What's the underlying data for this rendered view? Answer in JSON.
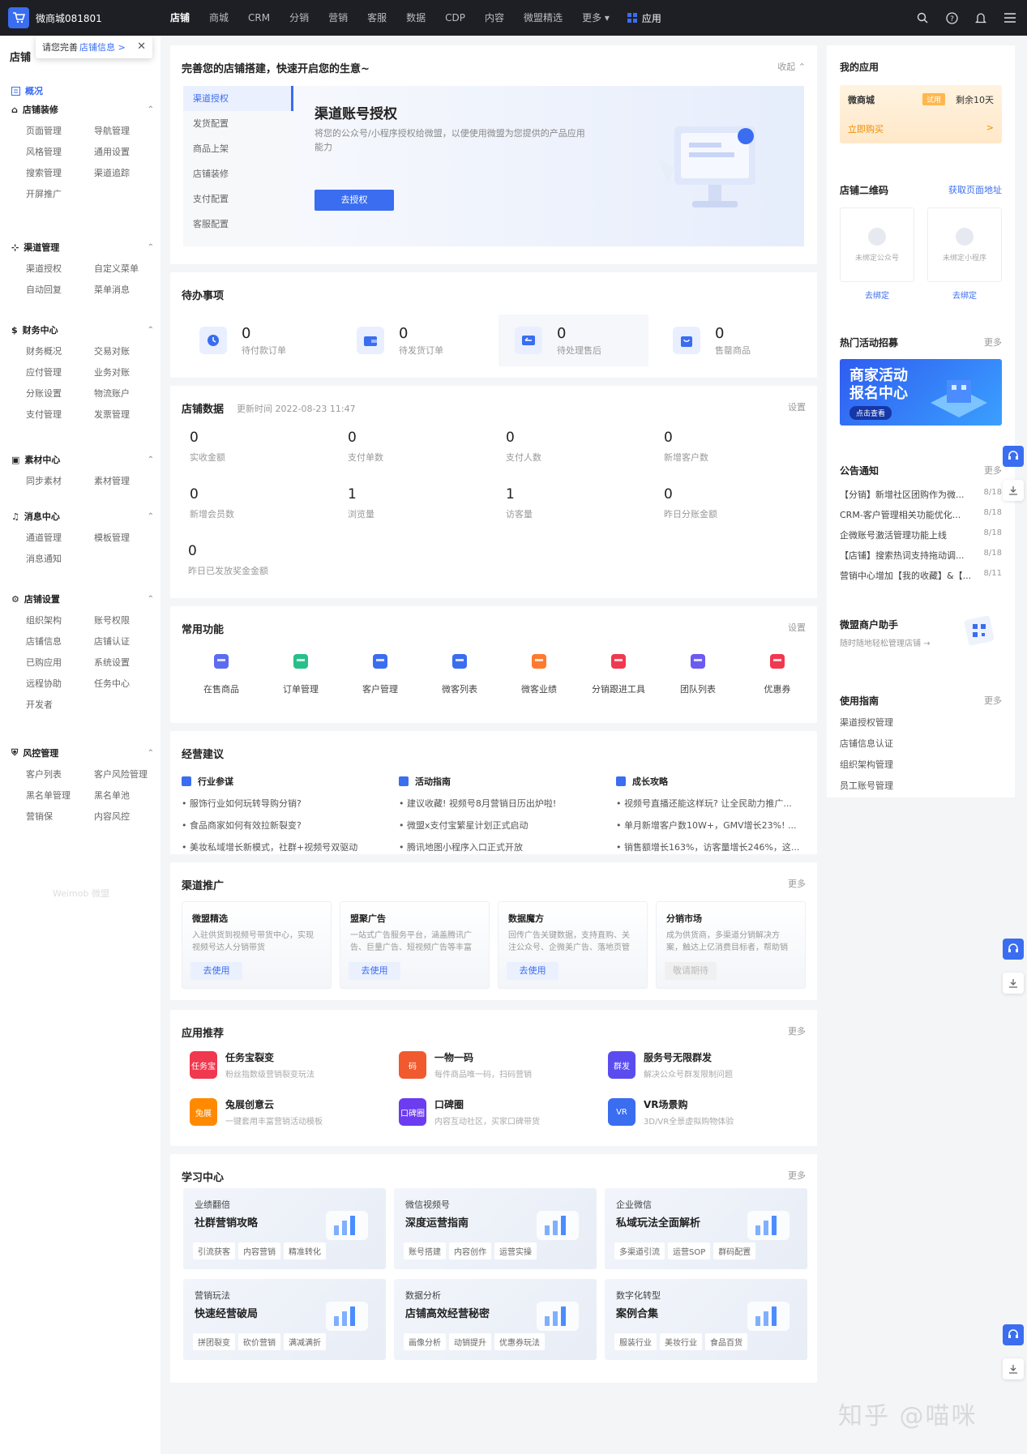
{
  "topbar": {
    "store_name": "微商城081801",
    "nav": [
      "店铺",
      "商城",
      "CRM",
      "分销",
      "营销",
      "客服",
      "数据",
      "CDP",
      "内容",
      "微盟精选",
      "更多 ▾"
    ],
    "apps_label": "应用"
  },
  "sidebar": {
    "title": "店铺",
    "tooltip": {
      "text": "请您完善",
      "link": "店铺信息 >",
      "close": "✕"
    },
    "overview": "概况",
    "groups": [
      {
        "name": "店铺装修",
        "items": [
          "页面管理",
          "导航管理",
          "风格管理",
          "通用设置",
          "搜索管理",
          "渠道追踪",
          "开屏推广"
        ]
      },
      {
        "name": "渠道管理",
        "items": [
          "渠道授权",
          "自定义菜单",
          "自动回复",
          "菜单消息"
        ]
      },
      {
        "name": "财务中心",
        "items": [
          "财务概况",
          "交易对账",
          "应付管理",
          "业务对账",
          "分账设置",
          "物流账户",
          "支付管理",
          "发票管理"
        ]
      },
      {
        "name": "素材中心",
        "items": [
          "同步素材",
          "素材管理"
        ]
      },
      {
        "name": "消息中心",
        "items": [
          "通道管理",
          "模板管理",
          "消息通知"
        ]
      },
      {
        "name": "店铺设置",
        "items": [
          "组织架构",
          "账号权限",
          "店铺信息",
          "店铺认证",
          "已购应用",
          "系统设置",
          "远程协助",
          "任务中心",
          "开发者"
        ]
      },
      {
        "name": "风控管理",
        "items": [
          "客户列表",
          "客户风险管理",
          "黑名单管理",
          "黑名单池",
          "营销保",
          "内容风控"
        ]
      }
    ],
    "footer": "Weimob 微盟"
  },
  "setup": {
    "title": "完善您的店铺搭建，快速开启您的生意~",
    "collapse": "收起 ⌃",
    "steps": [
      "渠道授权",
      "发货配置",
      "商品上架",
      "店铺装修",
      "支付配置",
      "客服配置"
    ],
    "hero_title": "渠道账号授权",
    "hero_desc": "将您的公众号/小程序授权给微盟，以便使用微盟为您提供的产品应用能力",
    "hero_button": "去授权"
  },
  "todo": {
    "title": "待办事项",
    "items": [
      {
        "num": "0",
        "label": "待付款订单"
      },
      {
        "num": "0",
        "label": "待发货订单"
      },
      {
        "num": "0",
        "label": "待处理售后"
      },
      {
        "num": "0",
        "label": "售罄商品"
      }
    ]
  },
  "store_data": {
    "title": "店铺数据",
    "updated": "更新时间 2022-08-23 11:47",
    "settings": "设置",
    "stats": [
      {
        "num": "0",
        "label": "实收金额"
      },
      {
        "num": "0",
        "label": "支付单数"
      },
      {
        "num": "0",
        "label": "支付人数"
      },
      {
        "num": "0",
        "label": "新增客户数"
      },
      {
        "num": "0",
        "label": "新增会员数"
      },
      {
        "num": "1",
        "label": "浏览量"
      },
      {
        "num": "1",
        "label": "访客量"
      },
      {
        "num": "0",
        "label": "昨日分账金额"
      },
      {
        "num": "0",
        "label": "昨日已发放奖金金额"
      }
    ]
  },
  "common": {
    "title": "常用功能",
    "settings": "设置",
    "items": [
      "在售商品",
      "订单管理",
      "客户管理",
      "微客列表",
      "微客业绩",
      "分销跟进工具",
      "团队列表",
      "优惠券"
    ],
    "colors": [
      "#5b6cf0",
      "#27c08a",
      "#3a6df0",
      "#3a6df0",
      "#ff7a2e",
      "#f0384f",
      "#6b5bf0",
      "#f0384f"
    ]
  },
  "advice": {
    "title": "经营建议",
    "columns": [
      {
        "head": "行业参谋",
        "items": [
          "服饰行业如何玩转导购分销?",
          "食品商家如何有效拉新裂变?",
          "美妆私域增长新模式，社群+视频号双驱动"
        ]
      },
      {
        "head": "活动指南",
        "items": [
          "建议收藏! 视频号8月营销日历出炉啦!",
          "微盟x支付宝繁星计划正式启动",
          "腾讯地图小程序入口正式开放"
        ]
      },
      {
        "head": "成长攻略",
        "items": [
          "视频号直播还能这样玩? 让全民助力推广...",
          "单月新增客户数10W+，GMV增长23%! ...",
          "销售额增长163%，访客量增长246%，这..."
        ]
      }
    ]
  },
  "channel": {
    "title": "渠道推广",
    "more": "更多",
    "items": [
      {
        "name": "微盟精选",
        "desc": "入驻供货到视频号带货中心，实现视频号达人分销带货",
        "btn": "去使用",
        "disabled": false
      },
      {
        "name": "盟聚广告",
        "desc": "一站式广告服务平台，涵盖腾讯广告、巨量广告、短视频广告等丰富",
        "btn": "去使用",
        "disabled": false
      },
      {
        "name": "数据魔方",
        "desc": "回传广告关键数据，支持直购、关注公众号、企微美广告、落地页管理",
        "btn": "去使用",
        "disabled": false
      },
      {
        "name": "分销市场",
        "desc": "成为供货商，多渠道分销解决方案，触达上亿消费目标者，帮助销售和",
        "btn": "敬请期待",
        "disabled": true
      }
    ]
  },
  "apps": {
    "title": "应用推荐",
    "more": "更多",
    "items": [
      {
        "name": "任务宝裂变",
        "desc": "粉丝指数级营销裂变玩法",
        "color": "#f0384f",
        "glyph": "任务宝"
      },
      {
        "name": "一物一码",
        "desc": "每件商品唯一码，扫码营销",
        "color": "#f05a2e",
        "glyph": "码"
      },
      {
        "name": "服务号无限群发",
        "desc": "解决公众号群发限制问题",
        "color": "#5b4cf0",
        "glyph": "群发"
      },
      {
        "name": "兔展创意云",
        "desc": "一键套用丰富营销活动模板",
        "color": "#ff8a00",
        "glyph": "兔展"
      },
      {
        "name": "口碑圈",
        "desc": "内容互动社区，买家口碑带货",
        "color": "#6b3cf0",
        "glyph": "口碑圈"
      },
      {
        "name": "VR场景购",
        "desc": "3D/VR全景虚拟购物体验",
        "color": "#3a6df0",
        "glyph": "VR"
      }
    ]
  },
  "learning": {
    "title": "学习中心",
    "more": "更多",
    "items": [
      {
        "cat": "业绩翻倍",
        "title": "社群营销攻略",
        "tags": [
          "引流获客",
          "内容营销",
          "精准转化"
        ]
      },
      {
        "cat": "微信视频号",
        "title": "深度运营指南",
        "tags": [
          "账号搭建",
          "内容创作",
          "运营实操"
        ]
      },
      {
        "cat": "企业微信",
        "title": "私域玩法全面解析",
        "tags": [
          "多渠道引流",
          "运营SOP",
          "群码配置"
        ]
      },
      {
        "cat": "营销玩法",
        "title": "快速经营破局",
        "tags": [
          "拼团裂变",
          "砍价营销",
          "满减满折"
        ]
      },
      {
        "cat": "数据分析",
        "title": "店铺高效经营秘密",
        "tags": [
          "画像分析",
          "动销提升",
          "优惠券玩法"
        ]
      },
      {
        "cat": "数字化转型",
        "title": "案例合集",
        "tags": [
          "服装行业",
          "美妆行业",
          "食品百货"
        ]
      }
    ]
  },
  "right": {
    "my_apps": "我的应用",
    "mall": {
      "name": "微商城",
      "tag": "试用",
      "remain": "剩余10天",
      "buy": "立即购买",
      "arrow": ">"
    },
    "qr": {
      "title": "店铺二维码",
      "link": "获取页面地址",
      "items": [
        {
          "label": "未绑定公众号",
          "action": "去绑定"
        },
        {
          "label": "未绑定小程序",
          "action": "去绑定"
        }
      ]
    },
    "hot": {
      "title": "热门活动招募",
      "more": "更多",
      "banner_line1": "商家活动",
      "banner_line2": "报名中心",
      "banner_btn": "点击查看"
    },
    "notice": {
      "title": "公告通知",
      "more": "更多",
      "items": [
        {
          "text": "【分销】新增社区团购作为微...",
          "date": "8/18"
        },
        {
          "text": "CRM-客户管理相关功能优化...",
          "date": "8/18"
        },
        {
          "text": "企微账号激活管理功能上线",
          "date": "8/18"
        },
        {
          "text": "【店铺】搜索热词支持拖动调...",
          "date": "8/18"
        },
        {
          "text": "营销中心增加【我的收藏】&【...",
          "date": "8/11"
        }
      ]
    },
    "assistant": {
      "title": "微盟商户助手",
      "desc": "随时随地轻松管理店铺 →"
    },
    "guide": {
      "title": "使用指南",
      "more": "更多",
      "items": [
        "渠道授权管理",
        "店铺信息认证",
        "组织架构管理",
        "员工账号管理"
      ]
    }
  },
  "watermark": "知乎 @喵咪"
}
